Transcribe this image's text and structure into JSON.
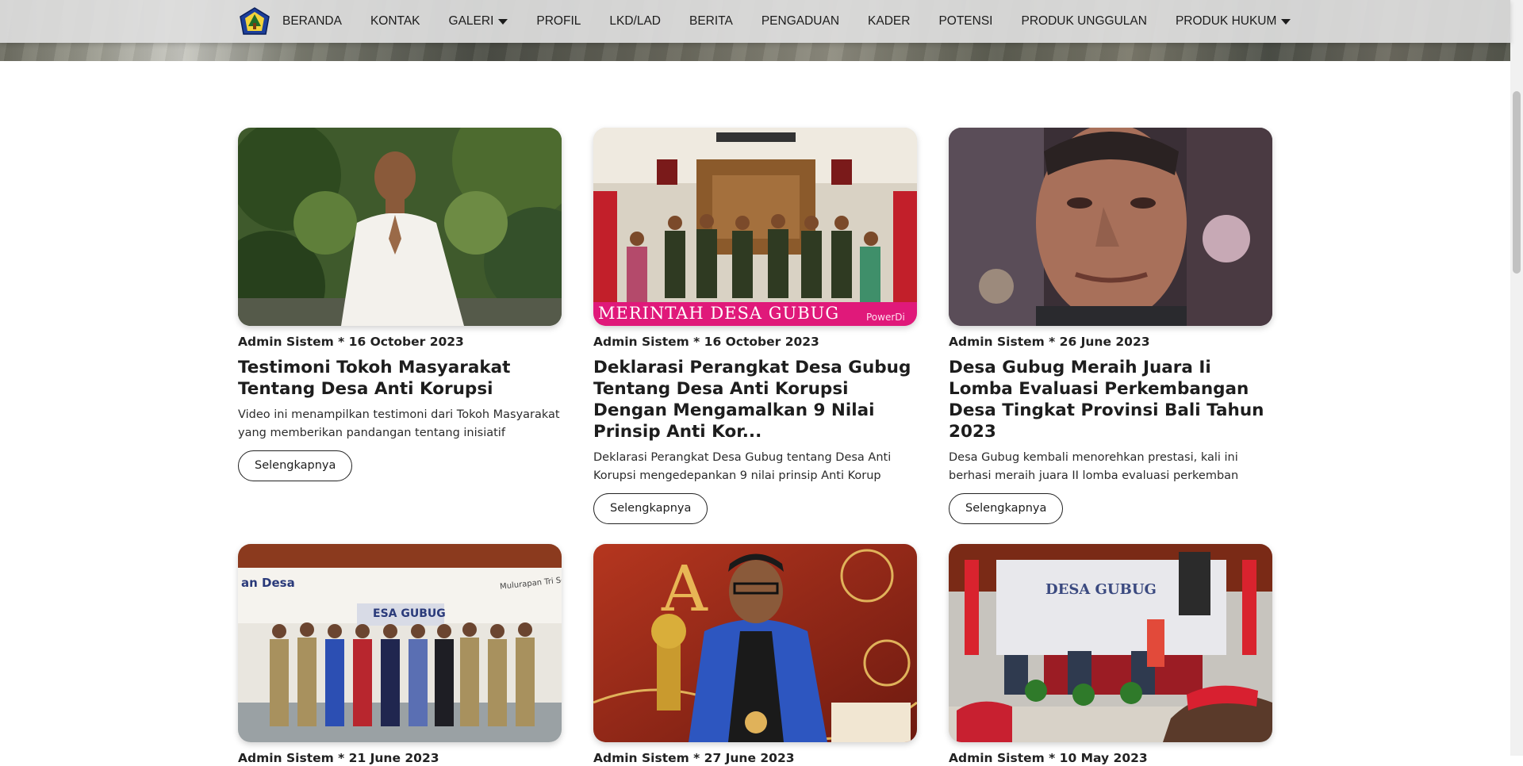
{
  "nav": {
    "items": [
      {
        "label": "BERANDA"
      },
      {
        "label": "KONTAK"
      },
      {
        "label": "GALERI",
        "dropdown": true
      },
      {
        "label": "PROFIL"
      },
      {
        "label": "LKD/LAD"
      },
      {
        "label": "BERITA"
      },
      {
        "label": "PENGADUAN"
      },
      {
        "label": "KADER"
      },
      {
        "label": "POTENSI"
      },
      {
        "label": "PRODUK UNGGULAN"
      },
      {
        "label": "PRODUK HUKUM",
        "dropdown": true
      }
    ]
  },
  "posts": [
    {
      "meta": "Admin Sistem * 16 October 2023",
      "title": "Testimoni Tokoh Masyarakat Tentang Desa Anti Korupsi",
      "excerpt_line1": "Video ini menampilkan testimoni dari Tokoh Masyarakat",
      "excerpt_line2": "yang memberikan pandangan tentang inisiatif",
      "button": "Selengkapnya"
    },
    {
      "meta": "Admin Sistem * 16 October 2023",
      "title": "Deklarasi Perangkat Desa Gubug Tentang Desa Anti Korupsi Dengan Mengamalkan 9 Nilai Prinsip Anti Kor...",
      "excerpt_line1": "Deklarasi Perangkat Desa Gubug tentang Desa Anti",
      "excerpt_line2": "Korupsi mengedepankan 9 nilai prinsip Anti Korup",
      "button": "Selengkapnya",
      "banner": "MERINTAH DESA GUBUG",
      "banner_small": "PowerDi"
    },
    {
      "meta": "Admin Sistem * 26 June 2023",
      "title": "Desa Gubug Meraih Juara Ii Lomba Evaluasi Perkembangan Desa Tingkat Provinsi Bali Tahun 2023",
      "excerpt_line1": "Desa Gubug kembali menorehkan prestasi, kali ini",
      "excerpt_line2": "berhasi meraih juara II lomba evaluasi perkemban",
      "button": "Selengkapnya"
    },
    {
      "meta": "Admin Sistem * 21 June 2023",
      "sign": "ESA GUBUG",
      "sign_left": "an Desa",
      "sign_right": "Mulurapan Tri Sem"
    },
    {
      "meta": "Admin Sistem * 27 June 2023",
      "letters": "A"
    },
    {
      "meta": "Admin Sistem * 10 May 2023",
      "sign": "DESA GUBUG"
    }
  ],
  "colors": {
    "navbar_bg": "#dedede",
    "text": "#1d1d1d",
    "button_border": "#222222",
    "banner_pink": "#e0197a"
  }
}
